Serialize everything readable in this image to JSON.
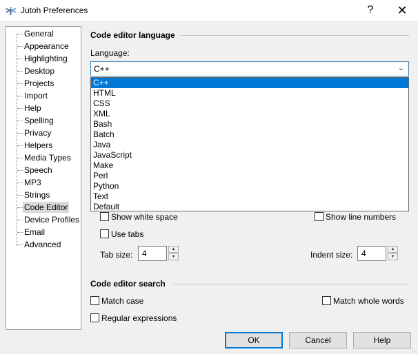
{
  "window": {
    "title": "Jutoh Preferences",
    "help_glyph": "?",
    "close_glyph": "✕"
  },
  "tree": {
    "items": [
      "General",
      "Appearance",
      "Highlighting",
      "Desktop",
      "Projects",
      "Import",
      "Help",
      "Spelling",
      "Privacy",
      "Helpers",
      "Media Types",
      "Speech",
      "MP3",
      "Strings",
      "Code Editor",
      "Device Profiles",
      "Email",
      "Advanced"
    ],
    "selected": "Code Editor"
  },
  "language_section": {
    "title": "Code editor language",
    "language_label": "Language:",
    "selected_value": "C++",
    "options": [
      "C++",
      "HTML",
      "CSS",
      "XML",
      "Bash",
      "Batch",
      "Java",
      "JavaScript",
      "Make",
      "Perl",
      "Python",
      "Text",
      "Default"
    ]
  },
  "options": {
    "show_white_space": "Show white space",
    "show_line_numbers": "Show line numbers",
    "use_tabs": "Use tabs",
    "tab_size_label": "Tab size:",
    "tab_size_value": "4",
    "indent_size_label": "Indent size:",
    "indent_size_value": "4"
  },
  "search_section": {
    "title": "Code editor search",
    "match_case": "Match case",
    "match_whole_words": "Match whole words",
    "regular_expressions": "Regular expressions"
  },
  "buttons": {
    "ok": "OK",
    "cancel": "Cancel",
    "help": "Help"
  }
}
